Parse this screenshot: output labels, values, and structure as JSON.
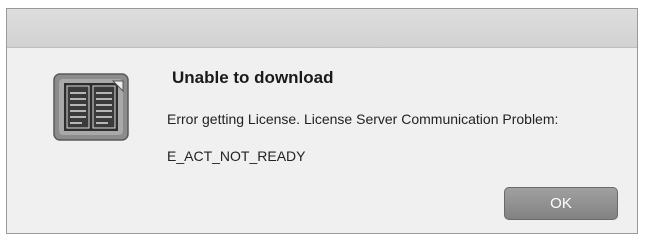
{
  "dialog": {
    "icon": "license-book-icon",
    "title": "Unable to download",
    "message": "Error getting License. License Server Communication Problem:",
    "error_code": "E_ACT_NOT_READY",
    "ok_label": "OK"
  }
}
